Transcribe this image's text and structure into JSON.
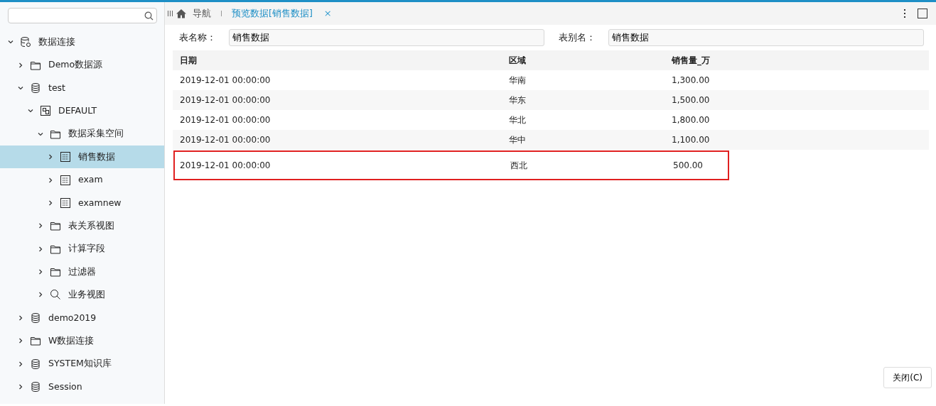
{
  "sidebar": {
    "tree": [
      {
        "label": "数据连接",
        "kind": "db-gear",
        "expanded": true,
        "selected": false,
        "children": [
          {
            "label": "Demo数据源",
            "kind": "folder",
            "expanded": false,
            "selected": false
          },
          {
            "label": "test",
            "kind": "db",
            "expanded": true,
            "selected": false,
            "children": [
              {
                "label": "DEFAULT",
                "kind": "schema",
                "expanded": true,
                "selected": false,
                "children": [
                  {
                    "label": "数据采集空间",
                    "kind": "folder",
                    "expanded": true,
                    "selected": false,
                    "children": [
                      {
                        "label": "销售数据",
                        "kind": "table",
                        "expanded": false,
                        "selected": true
                      },
                      {
                        "label": "exam",
                        "kind": "table",
                        "expanded": false,
                        "selected": false
                      },
                      {
                        "label": "examnew",
                        "kind": "table",
                        "expanded": false,
                        "selected": false
                      }
                    ]
                  },
                  {
                    "label": "表关系视图",
                    "kind": "folder",
                    "expanded": false,
                    "selected": false
                  },
                  {
                    "label": "计算字段",
                    "kind": "folder",
                    "expanded": false,
                    "selected": false
                  },
                  {
                    "label": "过滤器",
                    "kind": "folder",
                    "expanded": false,
                    "selected": false
                  },
                  {
                    "label": "业务视图",
                    "kind": "search",
                    "expanded": false,
                    "selected": false
                  }
                ]
              }
            ]
          },
          {
            "label": "demo2019",
            "kind": "db",
            "expanded": false,
            "selected": false
          },
          {
            "label": "W数据连接",
            "kind": "folder",
            "expanded": false,
            "selected": false
          },
          {
            "label": "SYSTEM知识库",
            "kind": "db",
            "expanded": false,
            "selected": false
          },
          {
            "label": "Session",
            "kind": "db",
            "expanded": false,
            "selected": false
          }
        ]
      }
    ]
  },
  "tabs": [
    {
      "label": "导航",
      "kind": "home",
      "selected": false
    },
    {
      "label": "预览数据[销售数据]",
      "kind": "doc",
      "selected": true,
      "close": "×"
    }
  ],
  "form": [
    {
      "label": "表名称：",
      "value": "销售数据"
    },
    {
      "label": "表别名：",
      "value": "销售数据"
    }
  ],
  "table": {
    "columns": [
      "日期",
      "区域",
      "销售量_万"
    ],
    "rows": [
      {
        "cells": [
          "2019-12-01 00:00:00",
          "华南",
          "1,300.00"
        ],
        "highlighted": false
      },
      {
        "cells": [
          "2019-12-01 00:00:00",
          "华东",
          "1,500.00"
        ],
        "highlighted": false
      },
      {
        "cells": [
          "2019-12-01 00:00:00",
          "华北",
          "1,800.00"
        ],
        "highlighted": false
      },
      {
        "cells": [
          "2019-12-01 00:00:00",
          "华中",
          "1,100.00"
        ],
        "highlighted": false
      },
      {
        "cells": [
          "2019-12-01 00:00:00",
          "西北",
          "500.00"
        ],
        "highlighted": true
      }
    ]
  },
  "close_button": "关闭(C)"
}
